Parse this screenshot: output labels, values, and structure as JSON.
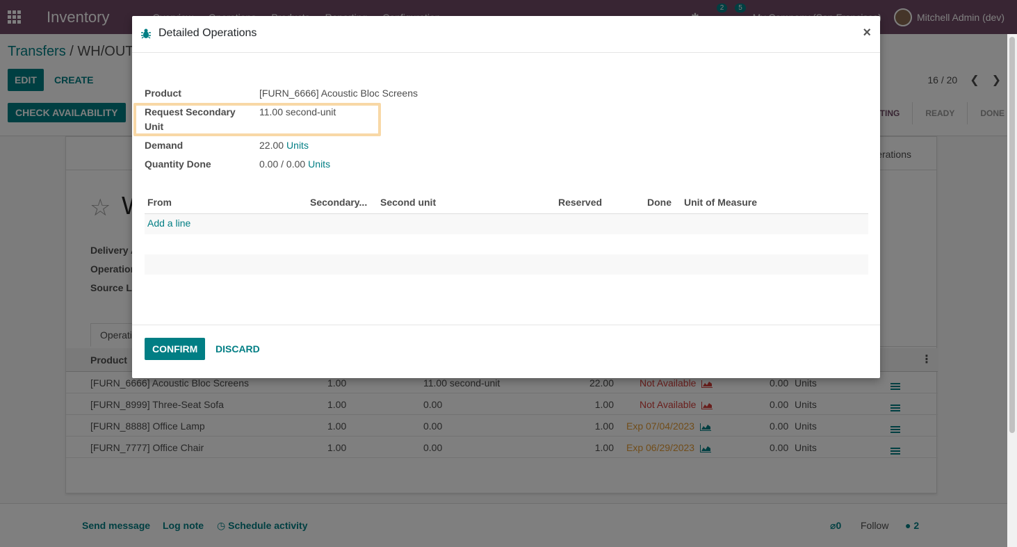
{
  "navbar": {
    "app_title": "Inventory",
    "menus": [
      "Overview",
      "Operations",
      "Products",
      "Reporting",
      "Configuration"
    ],
    "activity_count": "2",
    "message_count": "5",
    "company": "My Company (San Francisco)",
    "user": "Mitchell Admin (dev)"
  },
  "control": {
    "breadcrumb_parent": "Transfers",
    "breadcrumb_sep": "/",
    "breadcrumb_current": "WH/OUT",
    "edit_label": "EDIT",
    "create_label": "CREATE",
    "pager": "16 / 20",
    "check_availability_label": "CHECK AVAILABILITY",
    "status_waiting": "WAITING",
    "status_ready": "READY",
    "status_done": "DONE"
  },
  "sheet": {
    "detailed_ops_button": "erations",
    "title": "W",
    "field_delivery": "Delivery A",
    "field_operation": "Operation",
    "field_source": "Source Lo",
    "tab_operations": "Operati",
    "col_product": "Product",
    "rows": [
      {
        "product": "[FURN_6666] Acoustic Bloc Screens",
        "qty": "1.00",
        "secondary": "11.00 second-unit",
        "demand": "22.00",
        "availability": "Not Available",
        "done": "0.00",
        "uom": "Units",
        "status": "red"
      },
      {
        "product": "[FURN_8999] Three-Seat Sofa",
        "qty": "1.00",
        "secondary": "0.00",
        "demand": "1.00",
        "availability": "Not Available",
        "done": "0.00",
        "uom": "Units",
        "status": "red"
      },
      {
        "product": "[FURN_8888] Office Lamp",
        "qty": "1.00",
        "secondary": "0.00",
        "demand": "1.00",
        "availability": "Exp 07/04/2023",
        "done": "0.00",
        "uom": "Units",
        "status": "orange"
      },
      {
        "product": "[FURN_7777] Office Chair",
        "qty": "1.00",
        "secondary": "0.00",
        "demand": "1.00",
        "availability": "Exp 06/29/2023",
        "done": "0.00",
        "uom": "Units",
        "status": "orange"
      }
    ]
  },
  "chatter": {
    "send_message": "Send message",
    "log_note": "Log note",
    "schedule_activity": "Schedule activity",
    "attachments": "0",
    "follow": "Follow",
    "followers": "2"
  },
  "modal": {
    "title": "Detailed Operations",
    "close": "×",
    "product_label": "Product",
    "product_value": "[FURN_6666] Acoustic Bloc Screens",
    "req_secondary_label_1": "Request Secondary",
    "req_secondary_label_2": "Unit",
    "req_secondary_value": "11.00 second-unit",
    "demand_label": "Demand",
    "demand_value": "22.00",
    "demand_uom": "Units",
    "qty_done_label": "Quantity Done",
    "qty_done_value": "0.00",
    "qty_done_sep": "/",
    "qty_done_total": "0.00",
    "qty_done_uom": "Units",
    "columns": {
      "from": "From",
      "secondary": "Secondary...",
      "second_unit": "Second unit",
      "reserved": "Reserved",
      "done": "Done",
      "uom": "Unit of Measure"
    },
    "add_line": "Add a line",
    "confirm_label": "CONFIRM",
    "discard_label": "DISCARD"
  },
  "colors": {
    "brand": "#714b67",
    "accent": "#017e84",
    "highlight": "#f8d8a6"
  }
}
